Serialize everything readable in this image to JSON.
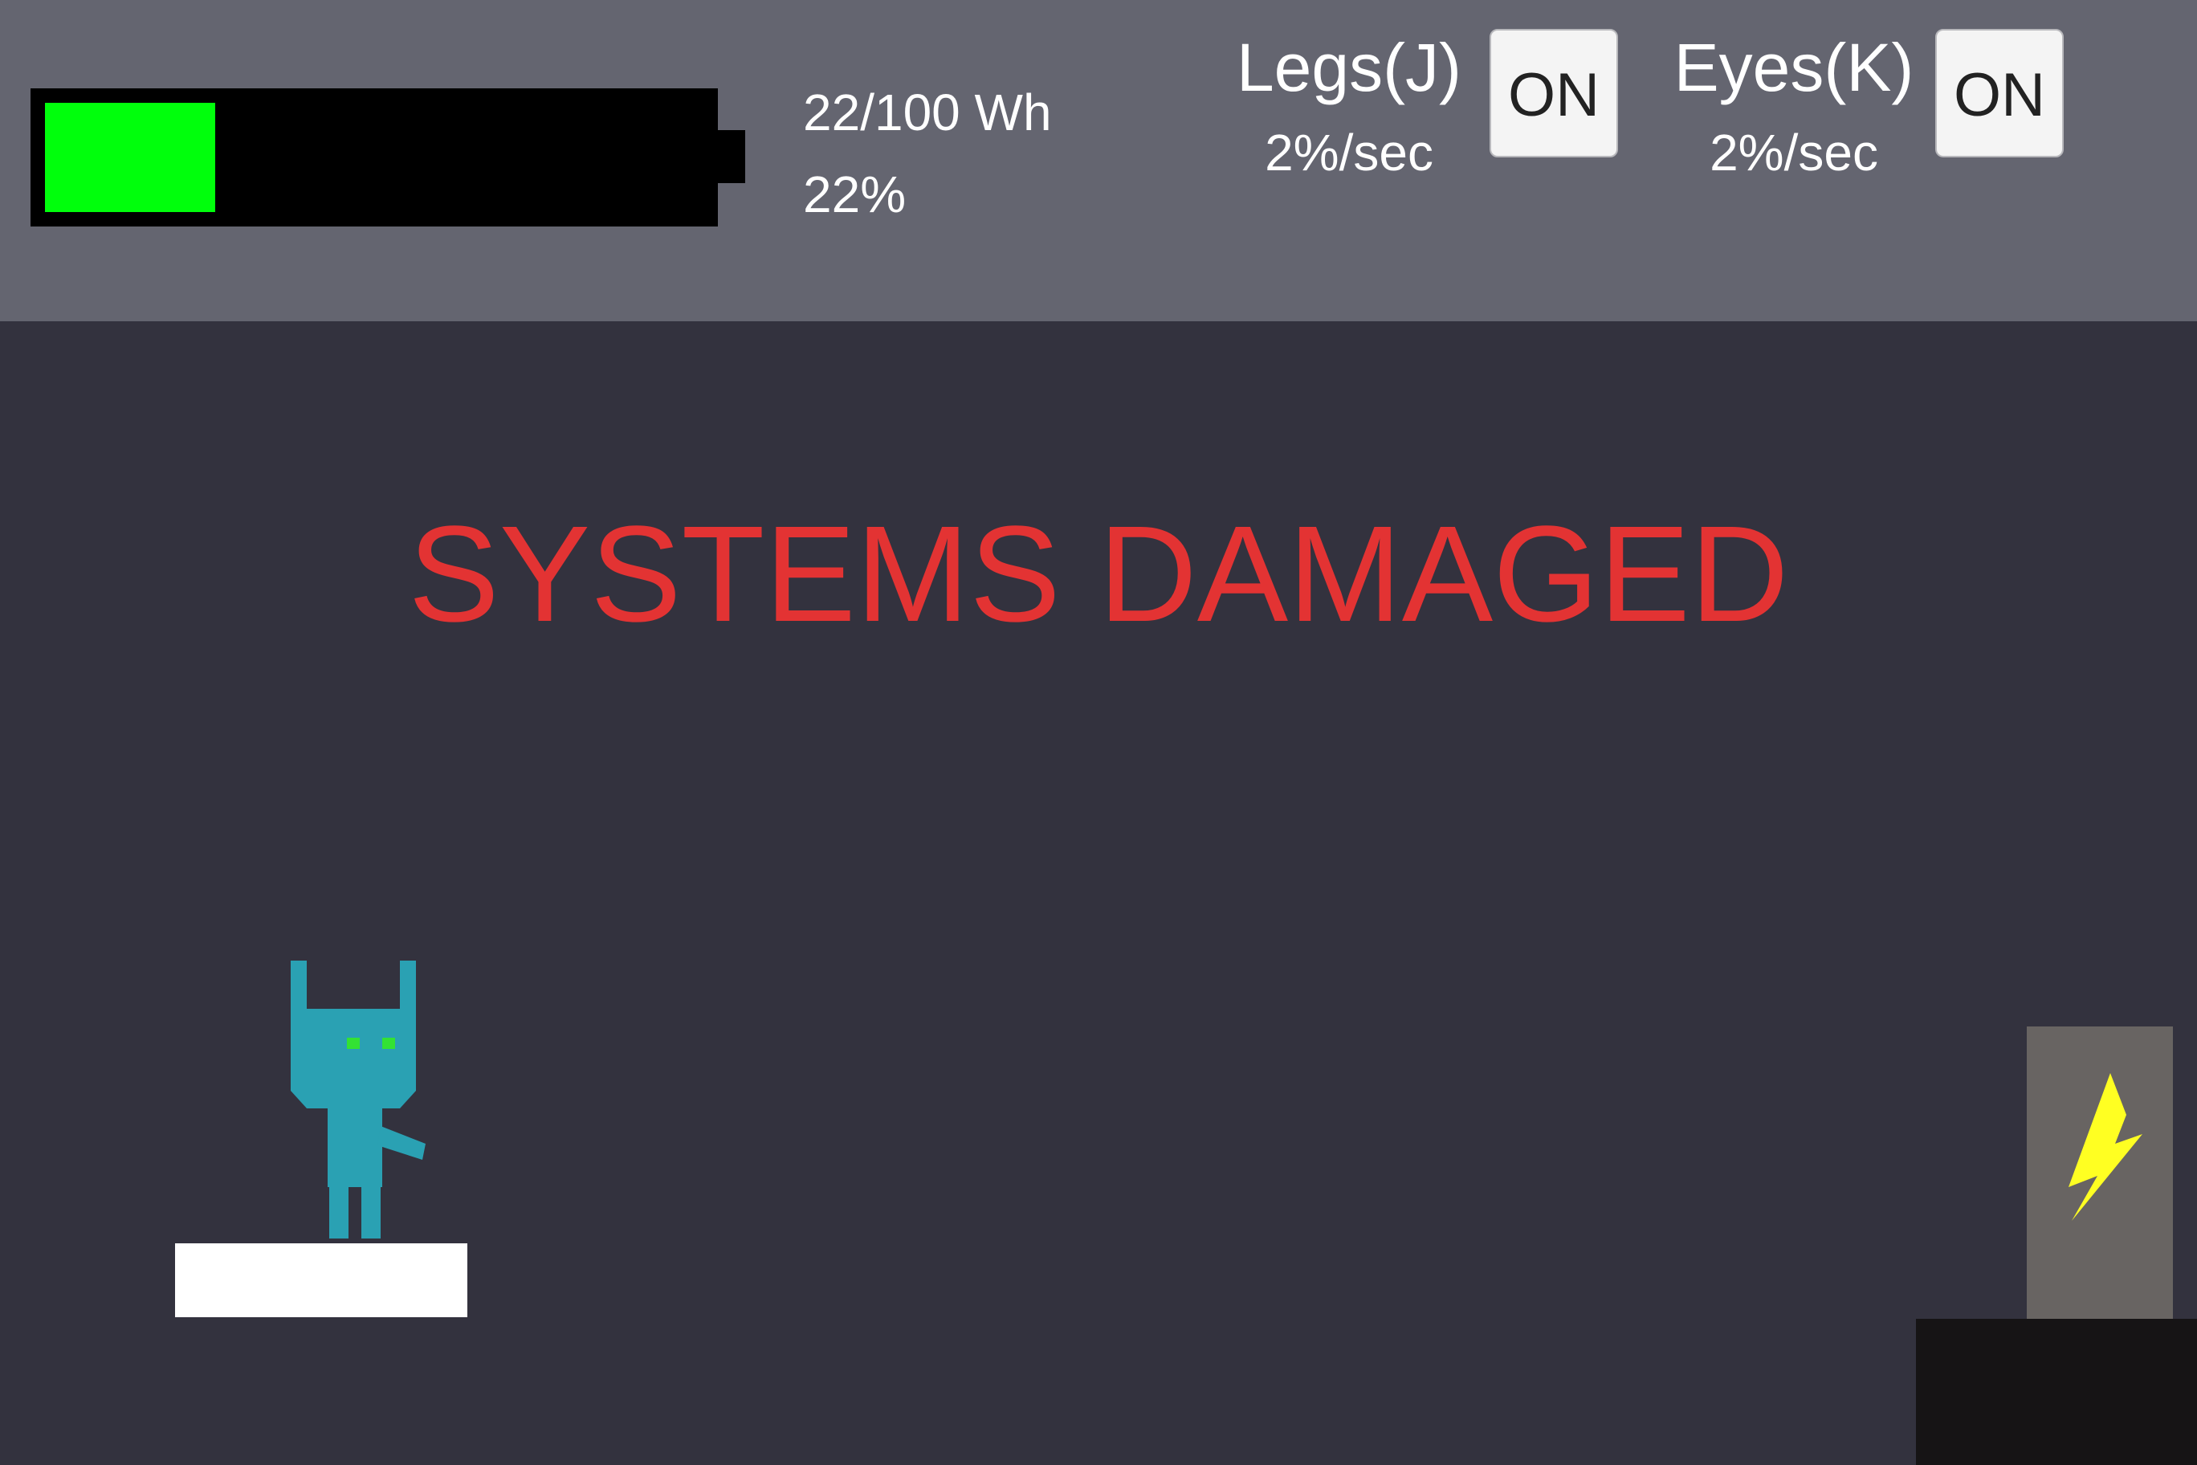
{
  "hud": {
    "battery": {
      "level_fraction": 0.22,
      "fill_color": "#00ff0c",
      "energy_text": "22/100 Wh",
      "percent_text": "22%"
    },
    "systems": [
      {
        "name": "Legs(J)",
        "rate": "2%/sec",
        "toggle_label": "ON"
      },
      {
        "name": "Eyes(K)",
        "rate": "2%/sec",
        "toggle_label": "ON"
      }
    ]
  },
  "status_message": "SYSTEMS DAMAGED",
  "colors": {
    "hud_background": "#646570",
    "scene_background": "#33323e",
    "status_message": "#e33333",
    "robot": "#2aa1b3",
    "robot_eyes": "#33e233",
    "charger_bolt": "#ffff22"
  },
  "scene": {
    "charger_icon": "lightning-bolt-icon"
  }
}
